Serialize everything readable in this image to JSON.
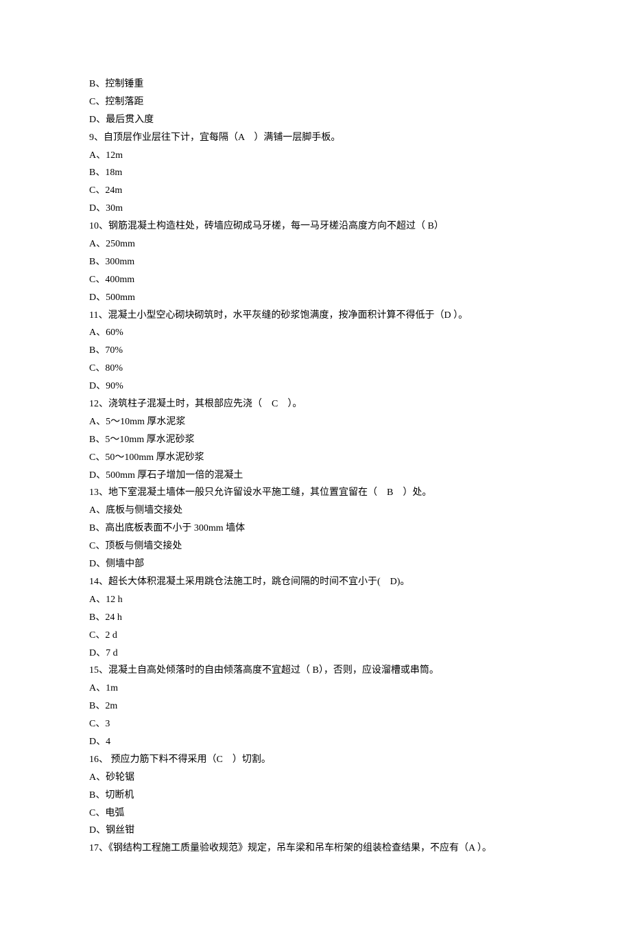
{
  "lines": [
    "B、控制锤重",
    "C、控制落距",
    "D、最后贯入度",
    "9、自顶层作业层往下计，宜每隔（A　）满铺一层脚手板。",
    "A、12m",
    "B、18m",
    "C、24m",
    "D、30m",
    "10、钢筋混凝土构造柱处，砖墙应砌成马牙槎，每一马牙槎沿高度方向不超过（ B）",
    "A、250mm",
    "B、300mm",
    "C、400mm",
    "D、500mm",
    "11、混凝土小型空心砌块砌筑时，水平灰缝的砂浆饱满度，按净面积计算不得低于（D ）。",
    "A、60%",
    "B、70%",
    "C、80%",
    "D、90%",
    "12、浇筑柱子混凝土时，其根部应先浇（　C　）。",
    "A、5～10mm 厚水泥浆",
    "B、5～10mm 厚水泥砂浆",
    "C、50～100mm 厚水泥砂浆",
    "D、500mm 厚石子增加一倍的混凝土",
    "13、地下室混凝土墙体一般只允许留设水平施工缝，其位置宜留在（　B　）处。",
    "A、底板与侧墙交接处",
    "B、高出底板表面不小于 300mm 墙体",
    "C、顶板与侧墙交接处",
    "D、侧墙中部",
    "14、超长大体积混凝土采用跳仓法施工时，跳仓间隔的时间不宜小于(　D)。",
    "A、12 h",
    "B、24 h",
    "C、2 d",
    "D、7 d",
    "15、混凝土自高处倾落时的自由倾落高度不宜超过（ B），否则，应设溜槽或串筒。",
    "A、1m",
    "B、2m",
    "C、3",
    "D、4",
    "16、 预应力筋下料不得采用（C　）切割。",
    "A、砂轮锯",
    "B、切断机",
    "C、电弧",
    "D、钢丝钳",
    "17、《钢结构工程施工质量验收规范》规定，吊车梁和吊车桁架的组装检查结果，不应有（A ）。"
  ]
}
